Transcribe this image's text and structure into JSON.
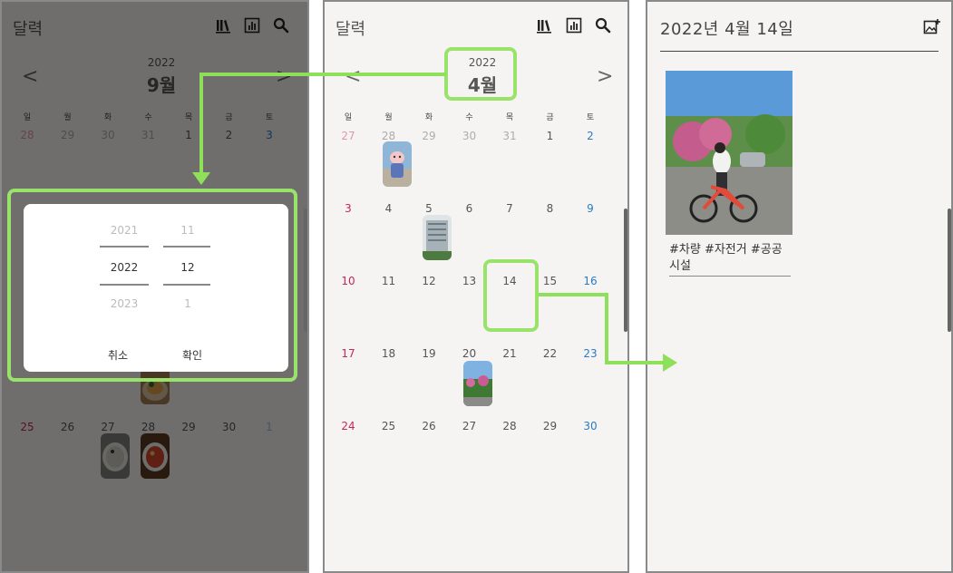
{
  "colors": {
    "highlight": "#9ae36b",
    "sunday": "#c0285a",
    "saturday": "#2b7bbf"
  },
  "screen1": {
    "app_title": "달력",
    "icons": [
      "books-icon",
      "chart-icon",
      "search-icon"
    ],
    "year": "2022",
    "month": "9월",
    "prev_arrow": "<",
    "next_arrow": ">",
    "weekdays": [
      "일",
      "월",
      "화",
      "수",
      "목",
      "금",
      "토"
    ],
    "row1": [
      "28",
      "29",
      "30",
      "31",
      "1",
      "2",
      "3"
    ],
    "row_last": [
      "25",
      "26",
      "27",
      "28",
      "29",
      "30",
      "1"
    ],
    "picker": {
      "year_prev": "2021",
      "year_selected": "2022",
      "year_next": "2023",
      "month_prev": "11",
      "month_selected": "12",
      "month_next": "1",
      "cancel_label": "취소",
      "confirm_label": "확인"
    }
  },
  "screen2": {
    "app_title": "달력",
    "year": "2022",
    "month": "4월",
    "prev_arrow": "<",
    "next_arrow": ">",
    "weekdays": [
      "일",
      "월",
      "화",
      "수",
      "목",
      "금",
      "토"
    ],
    "weeks": [
      [
        "27",
        "28",
        "29",
        "30",
        "31",
        "1",
        "2"
      ],
      [
        "3",
        "4",
        "5",
        "6",
        "7",
        "8",
        "9"
      ],
      [
        "10",
        "11",
        "12",
        "13",
        "14",
        "15",
        "16"
      ],
      [
        "17",
        "18",
        "19",
        "20",
        "21",
        "22",
        "23"
      ],
      [
        "24",
        "25",
        "26",
        "27",
        "28",
        "29",
        "30"
      ]
    ]
  },
  "screen3": {
    "date_title": "2022년 4월 14일",
    "tags": "#차량 #자전거 #공공 시설"
  }
}
